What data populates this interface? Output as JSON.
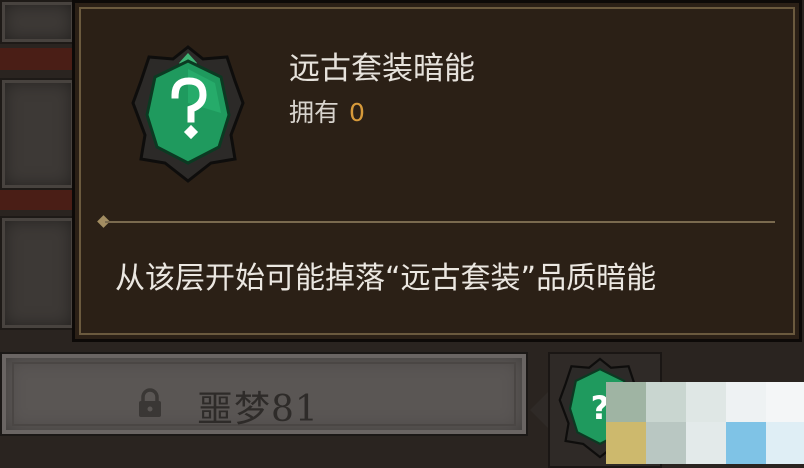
{
  "tooltip": {
    "title": "远古套装暗能",
    "owned_label": "拥有",
    "owned_count": "0",
    "description": "从该层开始可能掉落“远古套装”品质暗能",
    "gem_icon": "green-rune-gem-icon"
  },
  "level_row": {
    "label": "噩梦81",
    "locked": true,
    "lock_icon": "lock-icon"
  },
  "colors": {
    "gem_green": "#1f9a5e",
    "owned_value": "#d79a3a",
    "tooltip_bg": "#2b2016",
    "tooltip_border": "#6b5a3e"
  }
}
